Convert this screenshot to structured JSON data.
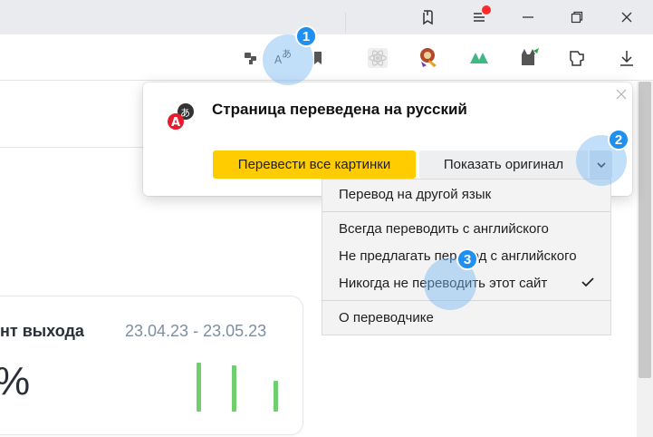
{
  "titlebar": {
    "icons": [
      "bookmarks-collections-icon",
      "menu-icon",
      "minimize-icon",
      "restore-icon",
      "close-icon"
    ],
    "notification_color": "#ff2a2a"
  },
  "toolbar": {
    "icons": [
      "extensions-icon",
      "translate-icon",
      "bookmark-icon",
      "react-devtools-icon",
      "extension-colorful-icon",
      "vue-devtools-icon",
      "extension-cat-icon",
      "extension-puzzle-icon",
      "download-icon"
    ]
  },
  "popup": {
    "title": "Страница переведена на русский",
    "translate_images_label": "Перевести все картинки",
    "show_original_label": "Показать оригинал",
    "accent_color": "#ffcc00"
  },
  "menu": {
    "items": [
      "Перевод на другой язык",
      "Всегда переводить с английского",
      "Не предлагать перевод с английского",
      "Никогда не переводить этот сайт",
      "О переводчике"
    ],
    "checked_item": "Никогда не переводить этот сайт"
  },
  "card": {
    "title": "нт выхода",
    "date_range": "23.04.23 - 23.05.23",
    "value": "%"
  },
  "chart_data": {
    "type": "bar",
    "values": [
      0.72,
      0.68,
      0.45
    ],
    "color": "#6fcf6f"
  },
  "hints": [
    "1",
    "2",
    "3"
  ],
  "hint_color": "#1f8ff0"
}
